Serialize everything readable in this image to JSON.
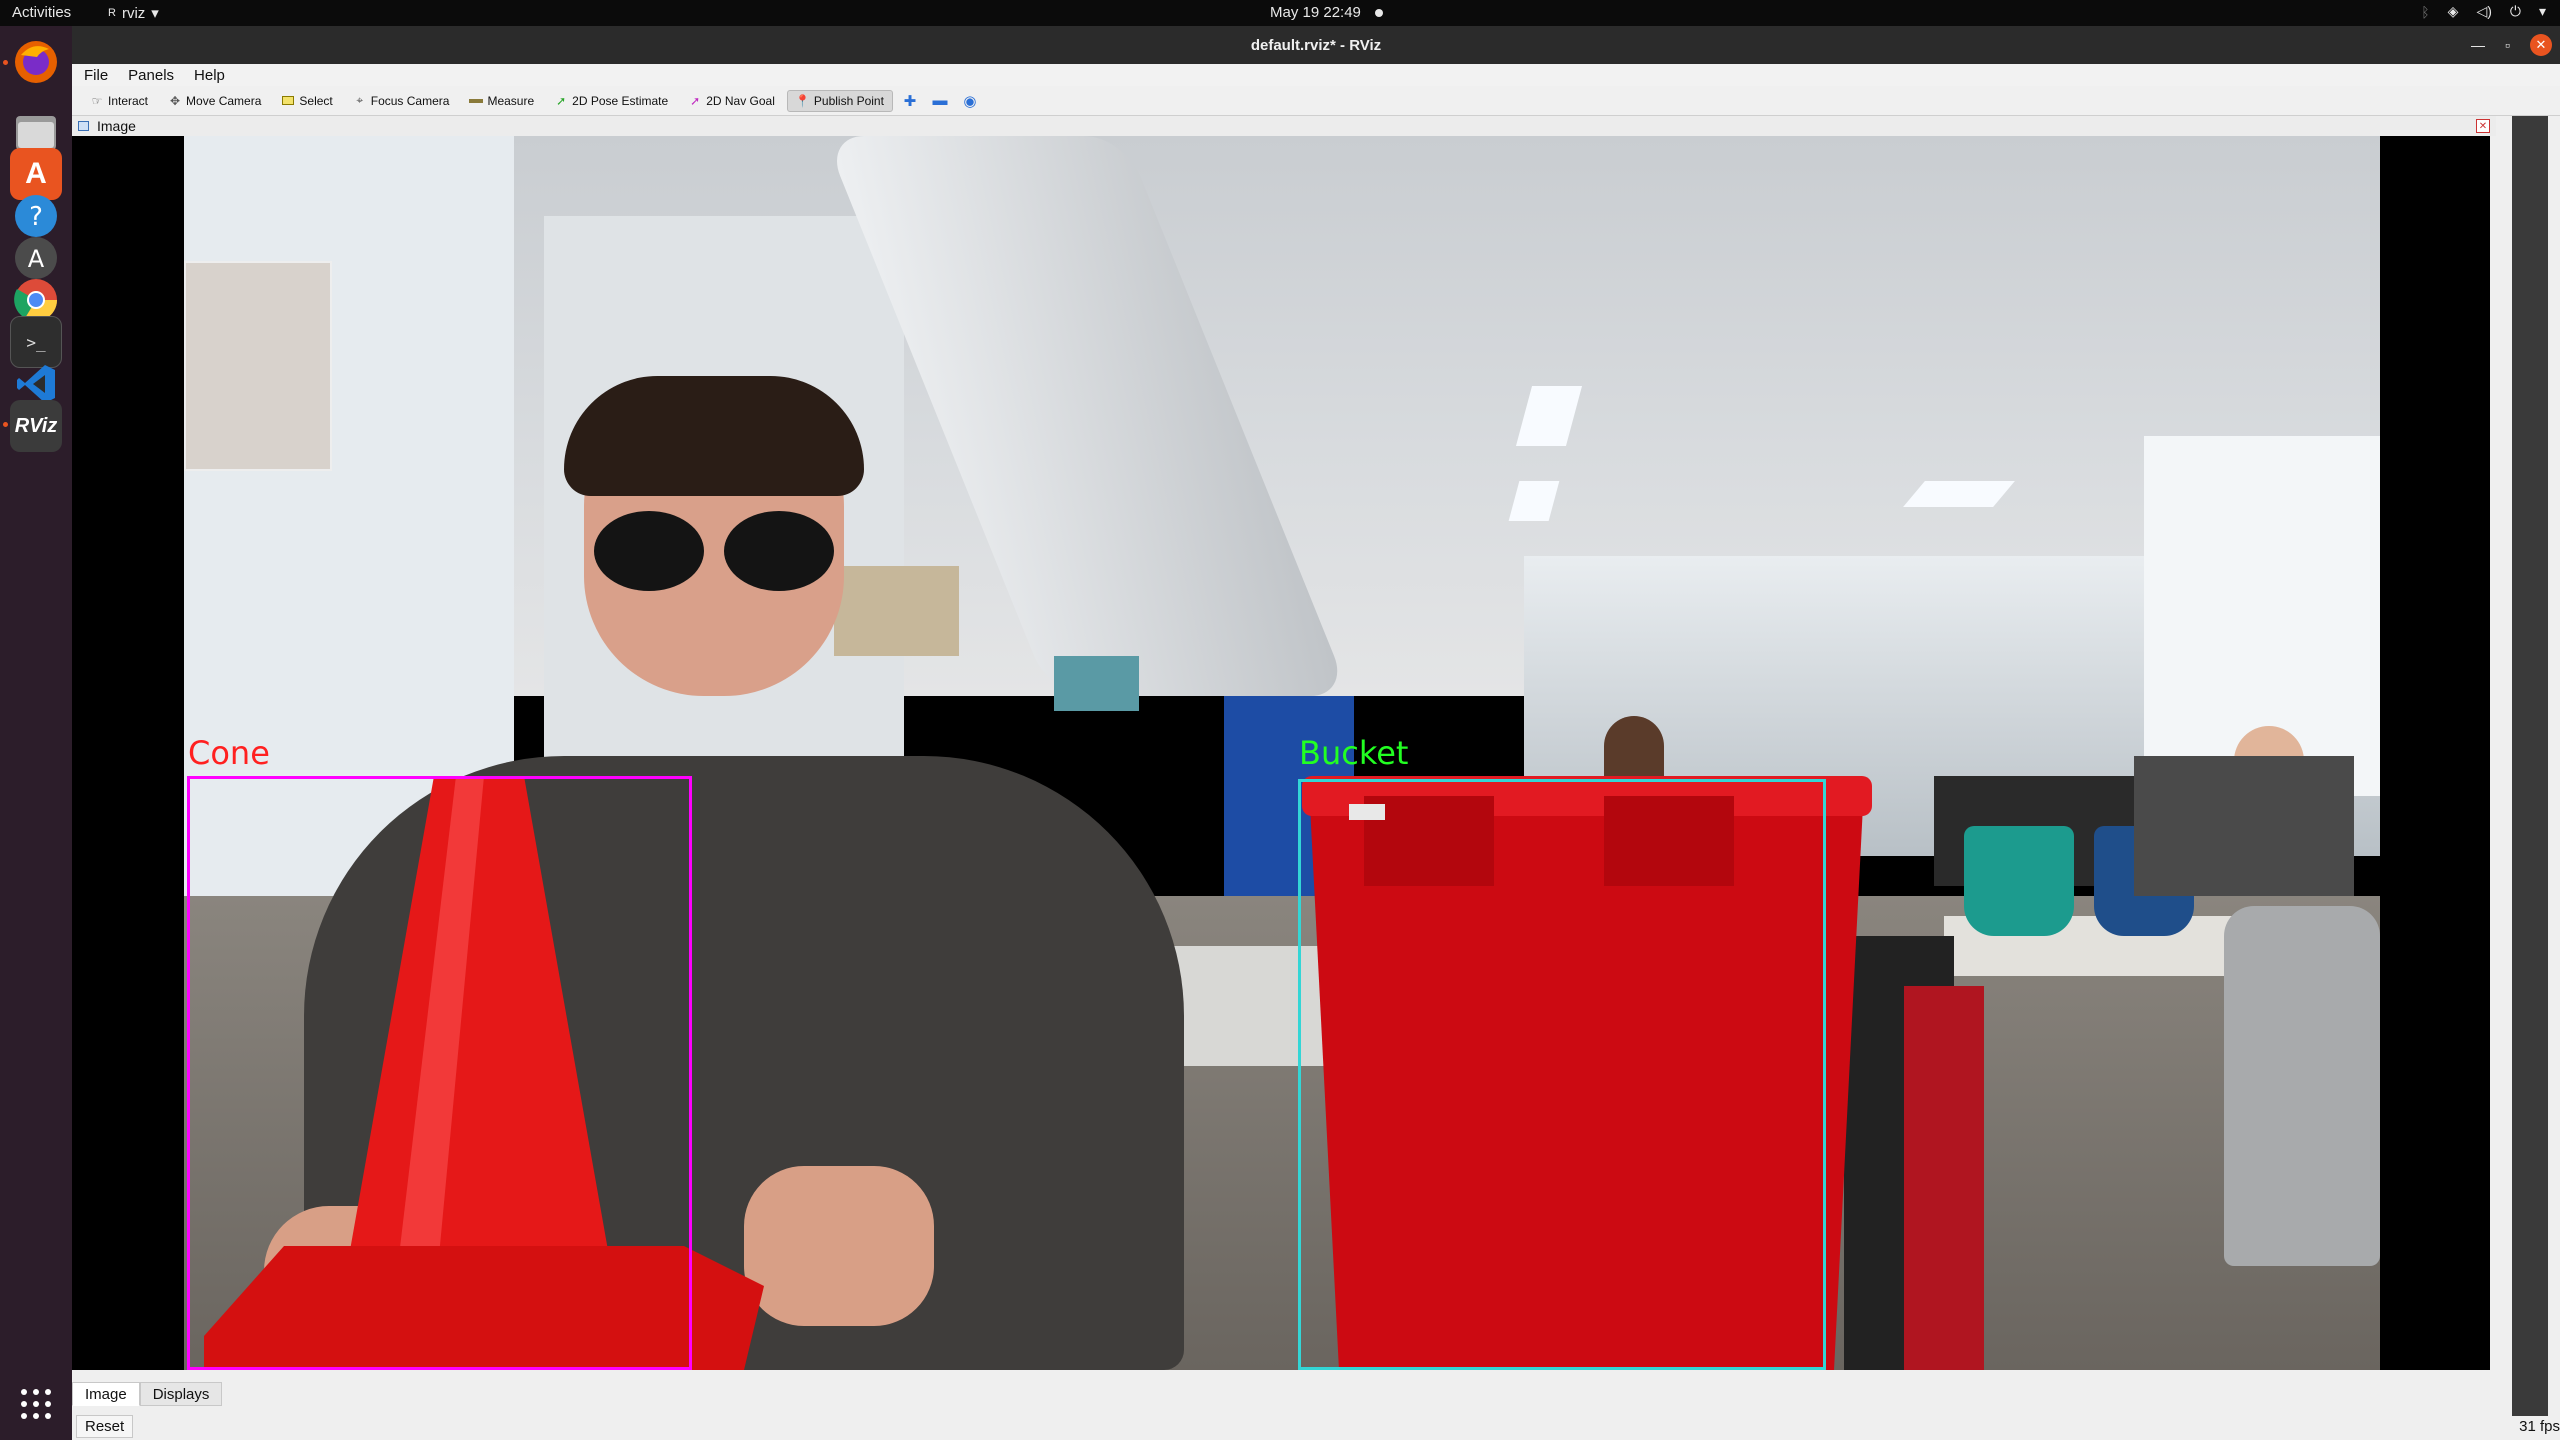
{
  "topbar": {
    "activities": "Activities",
    "app_name": "rviz",
    "clock": "May 19  22:49"
  },
  "dock": {
    "items": [
      {
        "name": "firefox-icon",
        "color": "#e66000"
      },
      {
        "name": "files-icon",
        "color": "#8a8a8a"
      },
      {
        "name": "app-center-icon",
        "color": "#e95420"
      },
      {
        "name": "help-icon",
        "color": "#2b8ad8"
      },
      {
        "name": "software-updater-icon",
        "color": "#4b4b4b"
      },
      {
        "name": "chrome-icon",
        "color": "#dd4b39"
      },
      {
        "name": "terminal-icon",
        "color": "#2e2e2e"
      },
      {
        "name": "vscode-icon",
        "color": "#1e7ad6"
      },
      {
        "name": "rviz-icon",
        "color": "#3b3b3b"
      }
    ]
  },
  "window": {
    "title": "default.rviz* - RViz"
  },
  "menubar": {
    "items": [
      "File",
      "Panels",
      "Help"
    ]
  },
  "toolbar": {
    "tools": [
      {
        "label": "Interact",
        "icon": "hand-icon",
        "color": "#555555"
      },
      {
        "label": "Move Camera",
        "icon": "move-icon",
        "color": "#555555"
      },
      {
        "label": "Select",
        "icon": "select-icon",
        "color": "#e6c000"
      },
      {
        "label": "Focus Camera",
        "icon": "focus-icon",
        "color": "#555555"
      },
      {
        "label": "Measure",
        "icon": "ruler-icon",
        "color": "#8a7a3a"
      },
      {
        "label": "2D Pose Estimate",
        "icon": "pose-arrow-icon",
        "color": "#2aa62a"
      },
      {
        "label": "2D Nav Goal",
        "icon": "nav-arrow-icon",
        "color": "#c02ac0"
      },
      {
        "label": "Publish Point",
        "icon": "pin-icon",
        "color": "#d02020"
      }
    ],
    "active": "Publish Point"
  },
  "panel": {
    "title": "Image"
  },
  "detections": [
    {
      "label": "Cone",
      "color": "#ff00ff",
      "text_color": "#ff2020"
    },
    {
      "label": "Bucket",
      "color": "#33d6d6",
      "text_color": "#22ff22"
    }
  ],
  "tabs": [
    "Image",
    "Displays"
  ],
  "statusbar": {
    "reset": "Reset",
    "fps": "31 fps"
  }
}
